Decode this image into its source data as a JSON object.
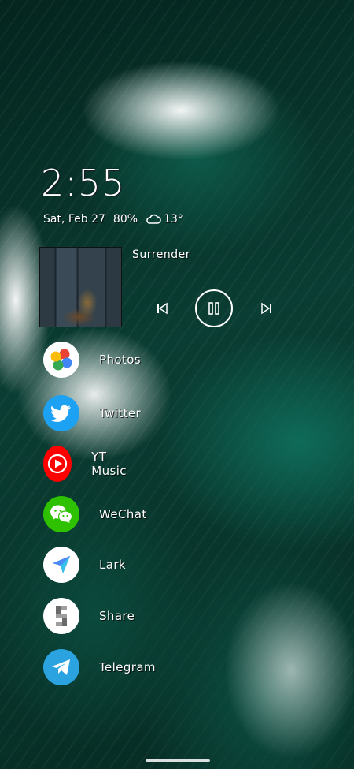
{
  "lockscreen": {
    "time": "2:55",
    "date": "Sat, Feb 27",
    "battery": "80%",
    "weather_icon": "cloud-icon",
    "temperature": "13°"
  },
  "media": {
    "track_title": "Surrender",
    "album_art": "album-art",
    "controls": [
      "previous-icon",
      "pause-icon",
      "next-icon"
    ]
  },
  "apps": [
    {
      "label": "Photos",
      "icon": "photos-icon"
    },
    {
      "label": "Twitter",
      "icon": "twitter-icon"
    },
    {
      "label": "YT Music",
      "icon": "yt-music-icon"
    },
    {
      "label": "WeChat",
      "icon": "wechat-icon"
    },
    {
      "label": "Lark",
      "icon": "lark-icon"
    },
    {
      "label": "Share",
      "icon": "share-icon"
    },
    {
      "label": "Telegram",
      "icon": "telegram-icon"
    }
  ],
  "colors": {
    "text": "#ffffff",
    "wallpaper_dark": "#052019",
    "twitter": "#1da1f2",
    "yt_music": "#ff0000",
    "wechat": "#2dc100",
    "telegram": "#2aa3e0"
  }
}
